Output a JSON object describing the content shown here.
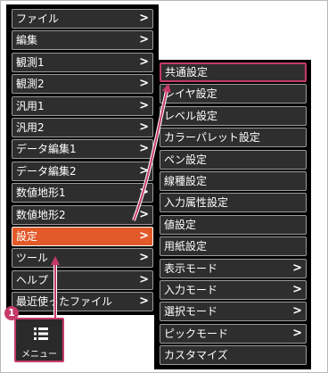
{
  "main_menu": {
    "items": [
      {
        "label": "ファイル",
        "chevron": true
      },
      {
        "label": "編集",
        "chevron": true
      },
      {
        "label": "観測1",
        "chevron": true
      },
      {
        "label": "観測2",
        "chevron": true
      },
      {
        "label": "汎用1",
        "chevron": true
      },
      {
        "label": "汎用2",
        "chevron": true
      },
      {
        "label": "データ編集1",
        "chevron": true
      },
      {
        "label": "データ編集2",
        "chevron": true
      },
      {
        "label": "数値地形1",
        "chevron": true
      },
      {
        "label": "数値地形2",
        "chevron": true
      },
      {
        "label": "設定",
        "chevron": true,
        "active": true
      },
      {
        "label": "ツール",
        "chevron": true
      },
      {
        "label": "ヘルプ",
        "chevron": true
      },
      {
        "label": "最近使ったファイル",
        "chevron": true
      }
    ]
  },
  "settings_submenu": {
    "items": [
      {
        "label": "共通設定",
        "chevron": false,
        "highlighted": true
      },
      {
        "label": "レイヤ設定",
        "chevron": false
      },
      {
        "label": "レベル設定",
        "chevron": false
      },
      {
        "label": "カラーパレット設定",
        "chevron": false
      },
      {
        "label": "ペン設定",
        "chevron": false
      },
      {
        "label": "線種設定",
        "chevron": false
      },
      {
        "label": "入力属性設定",
        "chevron": false
      },
      {
        "label": "値設定",
        "chevron": false
      },
      {
        "label": "用紙設定",
        "chevron": false
      },
      {
        "label": "表示モード",
        "chevron": true
      },
      {
        "label": "入力モード",
        "chevron": true
      },
      {
        "label": "選択モード",
        "chevron": true
      },
      {
        "label": "ピックモード",
        "chevron": true
      },
      {
        "label": "カスタマイズ",
        "chevron": false
      }
    ]
  },
  "menu_button": {
    "label": "メニュー",
    "icon": "list-menu-icon"
  },
  "step_badge": "1",
  "chevron_glyph": ">",
  "colors": {
    "active": "#e25a2a",
    "highlight_border": "#c53a68",
    "item_bg": "#2e2e2e"
  }
}
